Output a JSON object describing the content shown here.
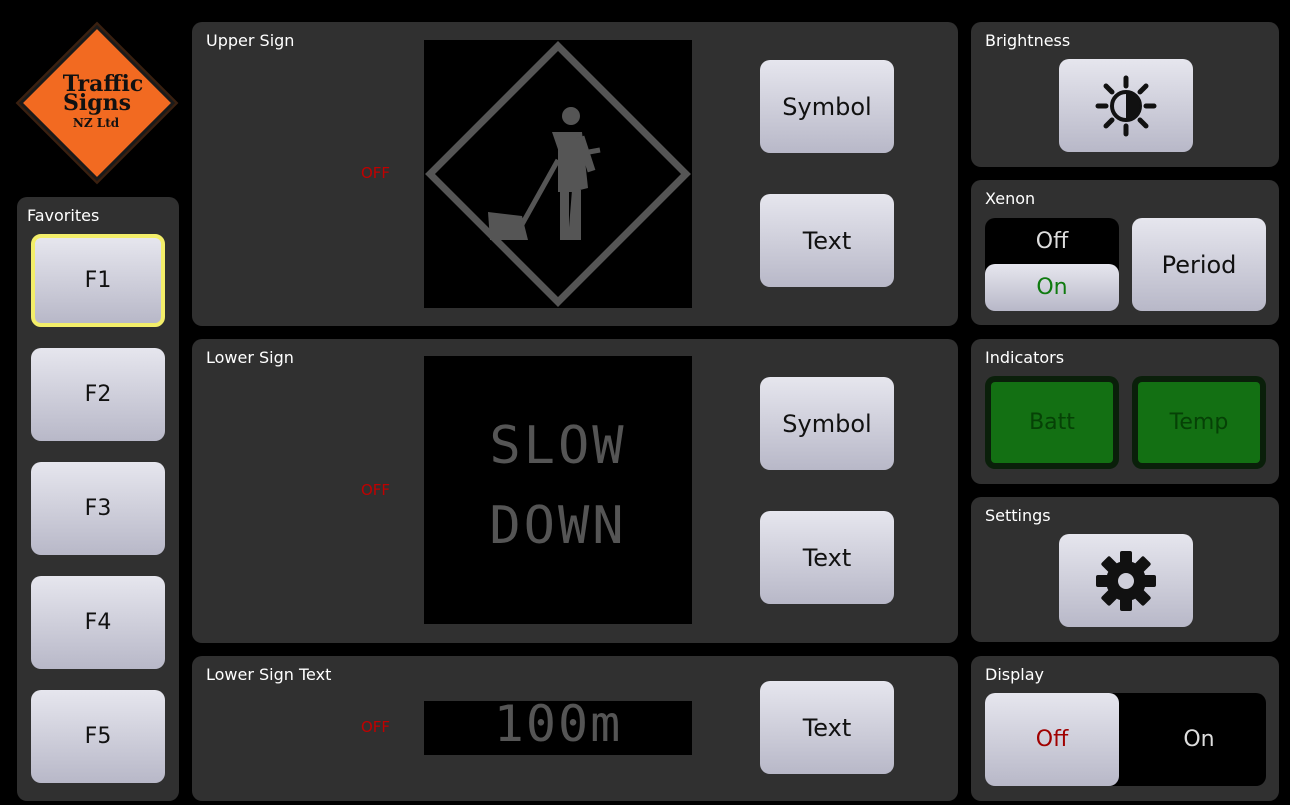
{
  "logo": {
    "line1": "Traffic",
    "line2": "Signs",
    "line3": "NZ Ltd"
  },
  "favorites": {
    "title": "Favorites",
    "items": [
      {
        "label": "F1",
        "selected": true
      },
      {
        "label": "F2",
        "selected": false
      },
      {
        "label": "F3",
        "selected": false
      },
      {
        "label": "F4",
        "selected": false
      },
      {
        "label": "F5",
        "selected": false
      }
    ]
  },
  "upper_sign": {
    "title": "Upper Sign",
    "status": "OFF",
    "symbol_label": "Symbol",
    "text_label": "Text",
    "display_icon": "roadworks-worker-icon"
  },
  "lower_sign": {
    "title": "Lower Sign",
    "status": "OFF",
    "symbol_label": "Symbol",
    "text_label": "Text",
    "display_line1": "SLOW",
    "display_line2": "DOWN"
  },
  "lower_sign_text": {
    "title": "Lower Sign Text",
    "status": "OFF",
    "text_label": "Text",
    "display_text": "100m"
  },
  "brightness": {
    "title": "Brightness",
    "icon": "brightness-icon"
  },
  "xenon": {
    "title": "Xenon",
    "off_label": "Off",
    "on_label": "On",
    "selected": "On",
    "period_label": "Period"
  },
  "indicators": {
    "title": "Indicators",
    "batt_label": "Batt",
    "temp_label": "Temp"
  },
  "settings": {
    "title": "Settings",
    "icon": "gear-icon"
  },
  "display": {
    "title": "Display",
    "off_label": "Off",
    "on_label": "On",
    "selected": "Off"
  },
  "colors": {
    "panel": "#303030",
    "off_red": "#c00000",
    "indicator_green": "#137013",
    "favorite_highlight": "#f3ee6a",
    "logo_orange": "#f26a21",
    "xenon_on_green": "#0f7a0f"
  }
}
